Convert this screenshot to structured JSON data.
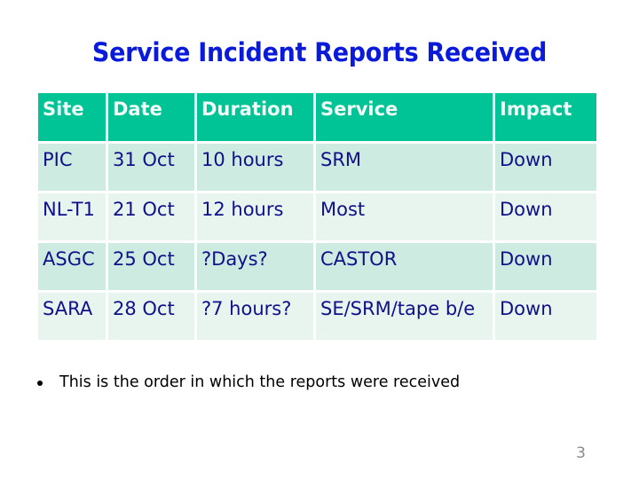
{
  "slide": {
    "title": "Service Incident Reports Received",
    "page_number": "3"
  },
  "table": {
    "headers": [
      "Site",
      "Date",
      "Duration",
      "Service",
      "Impact"
    ],
    "rows": [
      [
        "PIC",
        "31 Oct",
        "10 hours",
        "SRM",
        "Down"
      ],
      [
        "NL-T1",
        "21 Oct",
        "12 hours",
        "Most",
        "Down"
      ],
      [
        "ASGC",
        "25 Oct",
        "?Days?",
        "CASTOR",
        "Down"
      ],
      [
        "SARA",
        "28 Oct",
        "?7 hours?",
        "SE/SRM/tape b/e",
        "Down"
      ]
    ]
  },
  "bullets": [
    "This is the order in which the reports were received"
  ],
  "colors": {
    "title": "#0a1adb",
    "header_bg": "#00c495",
    "row_odd_bg": "#cdebe0",
    "row_even_bg": "#e8f5ef",
    "cell_text": "#10108a"
  }
}
